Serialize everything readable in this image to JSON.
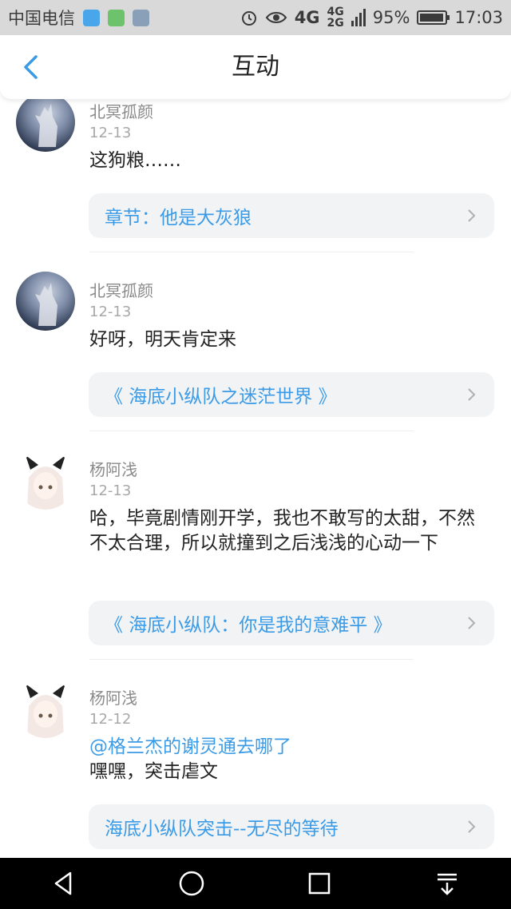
{
  "status": {
    "carrier": "中国电信",
    "network": "4G",
    "network_secondary_top": "4G",
    "network_secondary_bottom": "2G",
    "battery_percent": "95%",
    "battery_level": 0.95,
    "time": "17:03"
  },
  "header": {
    "title": "互动"
  },
  "feed": [
    {
      "avatar": "wolf-avatar",
      "user": "北冥孤颜",
      "date": "12-13",
      "content": "这狗粮……",
      "link": "章节：他是大灰狼"
    },
    {
      "avatar": "wolf-avatar",
      "user": "北冥孤颜",
      "date": "12-13",
      "content": "好呀，明天肯定来",
      "link": "《 海底小纵队之迷茫世界 》"
    },
    {
      "avatar": "girl-avatar",
      "user": "杨阿浅",
      "date": "12-13",
      "content": "哈，毕竟剧情刚开学，我也不敢写的太甜，不然不太合理，所以就撞到之后浅浅的心动一下",
      "link": "《 海底小纵队：你是我的意难平 》"
    },
    {
      "avatar": "girl-avatar",
      "user": "杨阿浅",
      "date": "12-12",
      "mention": "@格兰杰的谢灵通去哪了",
      "content": "嘿嘿，突击虐文",
      "link": "海底小纵队突击--无尽的等待"
    }
  ],
  "colors": {
    "accent": "#3b9be6",
    "card_bg": "#f2f3f5",
    "status_bg": "#d9d9d9"
  }
}
